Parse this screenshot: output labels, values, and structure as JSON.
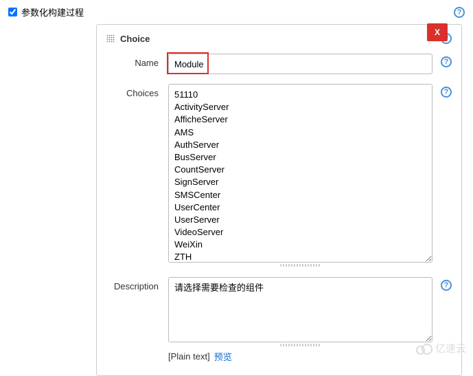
{
  "top": {
    "checkbox_label": "参数化构建过程",
    "checked": true
  },
  "panel": {
    "title": "Choice",
    "close_label": "X",
    "fields": {
      "name": {
        "label": "Name",
        "value": "Module"
      },
      "choices": {
        "label": "Choices",
        "value": "51110\nActivityServer\nAfficheServer\nAMS\nAuthServer\nBusServer\nCountServer\nSignServer\nSMSCenter\nUserCenter\nUserServer\nVideoServer\nWeiXin\nZTH"
      },
      "description": {
        "label": "Description",
        "value": "请选择需要检查的组件"
      }
    },
    "plaintext_label": "[Plain text]",
    "preview_label": "预览"
  },
  "watermark": {
    "text": "亿速云"
  }
}
